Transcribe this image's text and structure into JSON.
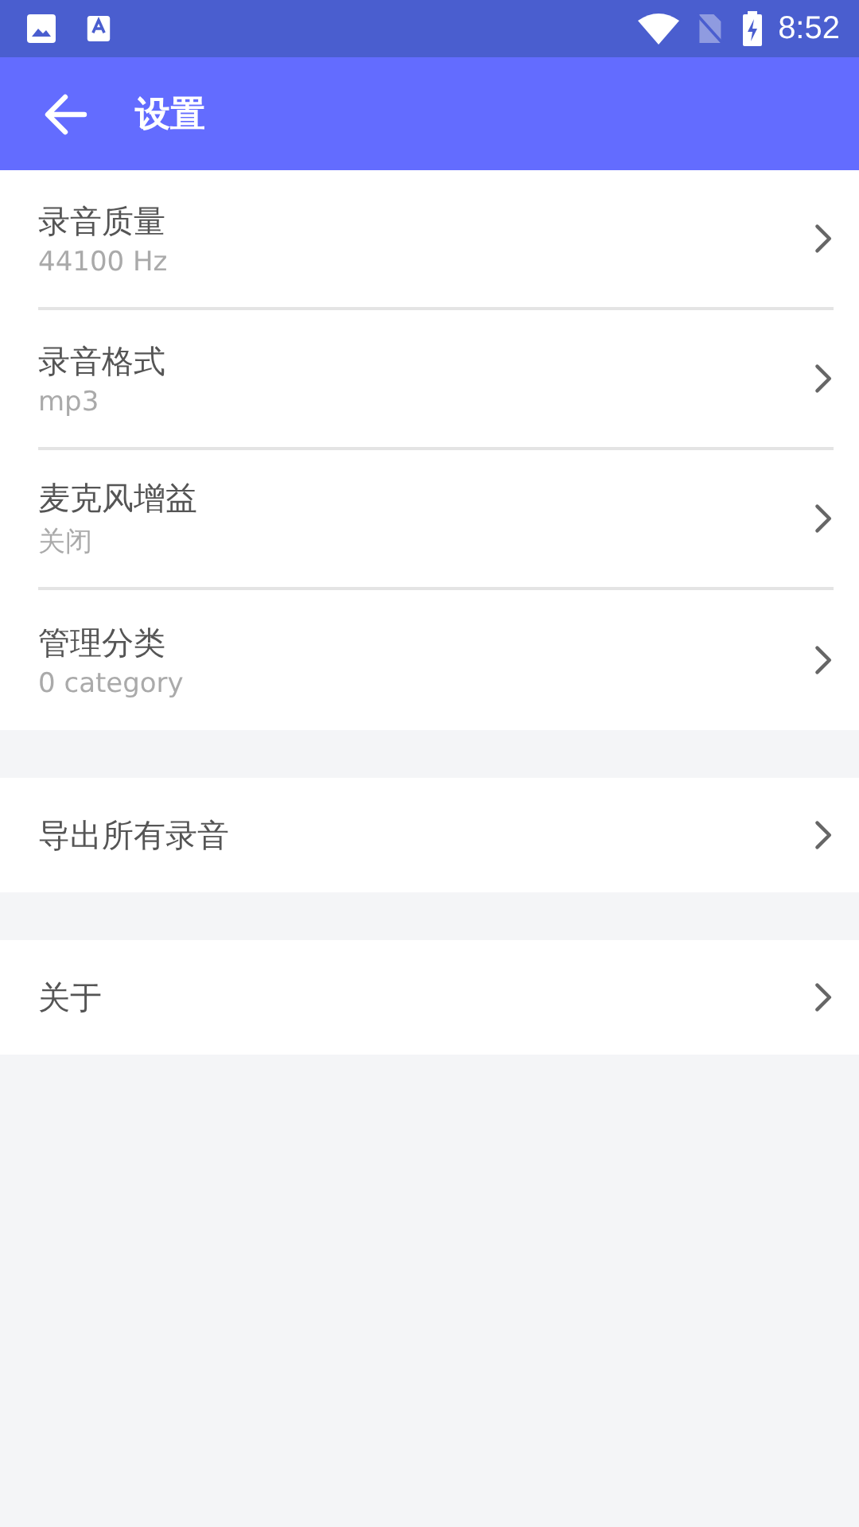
{
  "status_bar": {
    "time": "8:52"
  },
  "app_bar": {
    "title": "设置"
  },
  "groups": [
    {
      "items": [
        {
          "title": "录音质量",
          "subtitle": "44100 Hz"
        },
        {
          "title": "录音格式",
          "subtitle": "mp3"
        },
        {
          "title": "麦克风增益",
          "subtitle": "关闭"
        },
        {
          "title": "管理分类",
          "subtitle": "0 category"
        }
      ]
    },
    {
      "items": [
        {
          "title": "导出所有录音"
        }
      ]
    },
    {
      "items": [
        {
          "title": "关于"
        }
      ]
    }
  ]
}
